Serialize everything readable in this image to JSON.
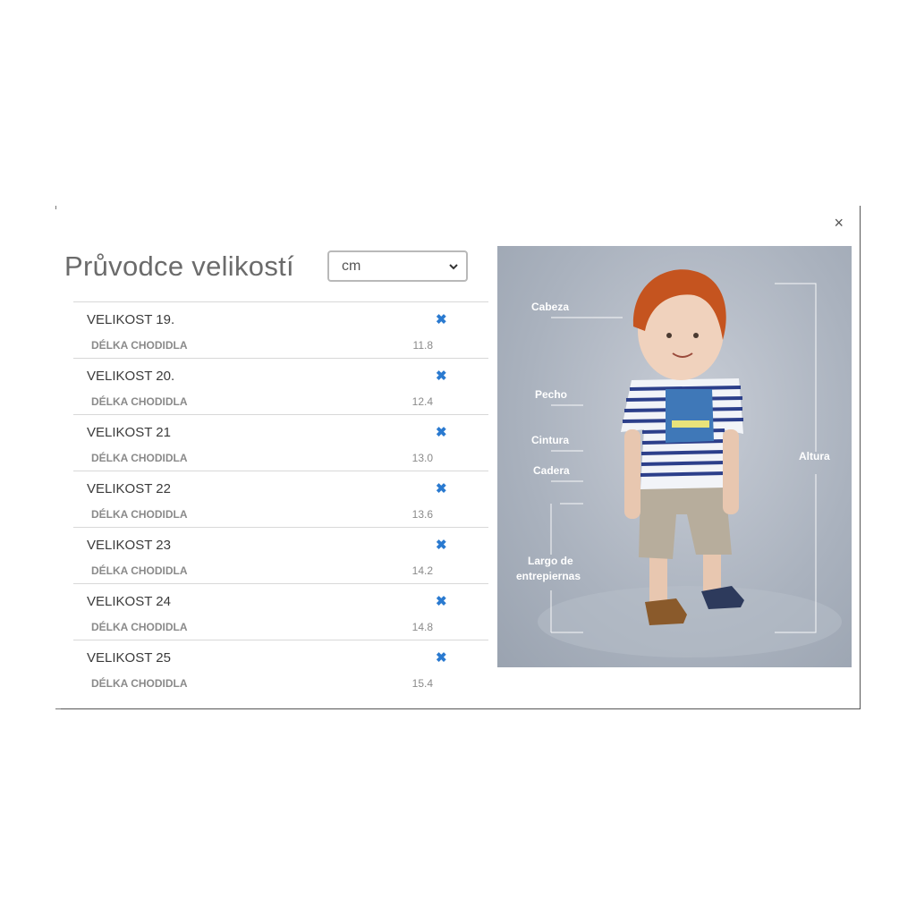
{
  "modal": {
    "title": "Průvodce velikostí",
    "close_label": "×"
  },
  "unit_select": {
    "selected": "cm"
  },
  "sizes": [
    {
      "name": "VELIKOST 19.",
      "measure_label": "DÉLKA CHODIDLA",
      "value": "11.8"
    },
    {
      "name": "VELIKOST 20.",
      "measure_label": "DÉLKA CHODIDLA",
      "value": "12.4"
    },
    {
      "name": "VELIKOST 21",
      "measure_label": "DÉLKA CHODIDLA",
      "value": "13.0"
    },
    {
      "name": "VELIKOST 22",
      "measure_label": "DÉLKA CHODIDLA",
      "value": "13.6"
    },
    {
      "name": "VELIKOST 23",
      "measure_label": "DÉLKA CHODIDLA",
      "value": "14.2"
    },
    {
      "name": "VELIKOST 24",
      "measure_label": "DÉLKA CHODIDLA",
      "value": "14.8"
    },
    {
      "name": "VELIKOST 25",
      "measure_label": "DÉLKA CHODIDLA",
      "value": "15.4"
    }
  ],
  "remove_icon_glyph": "✖",
  "accent_color": "#2a7ad0",
  "photo": {
    "labels": {
      "head": "Cabeza",
      "chest": "Pecho",
      "waist": "Cintura",
      "hip": "Cadera",
      "inseam_line1": "Largo de",
      "inseam_line2": "entrepiernas",
      "height": "Altura"
    }
  }
}
